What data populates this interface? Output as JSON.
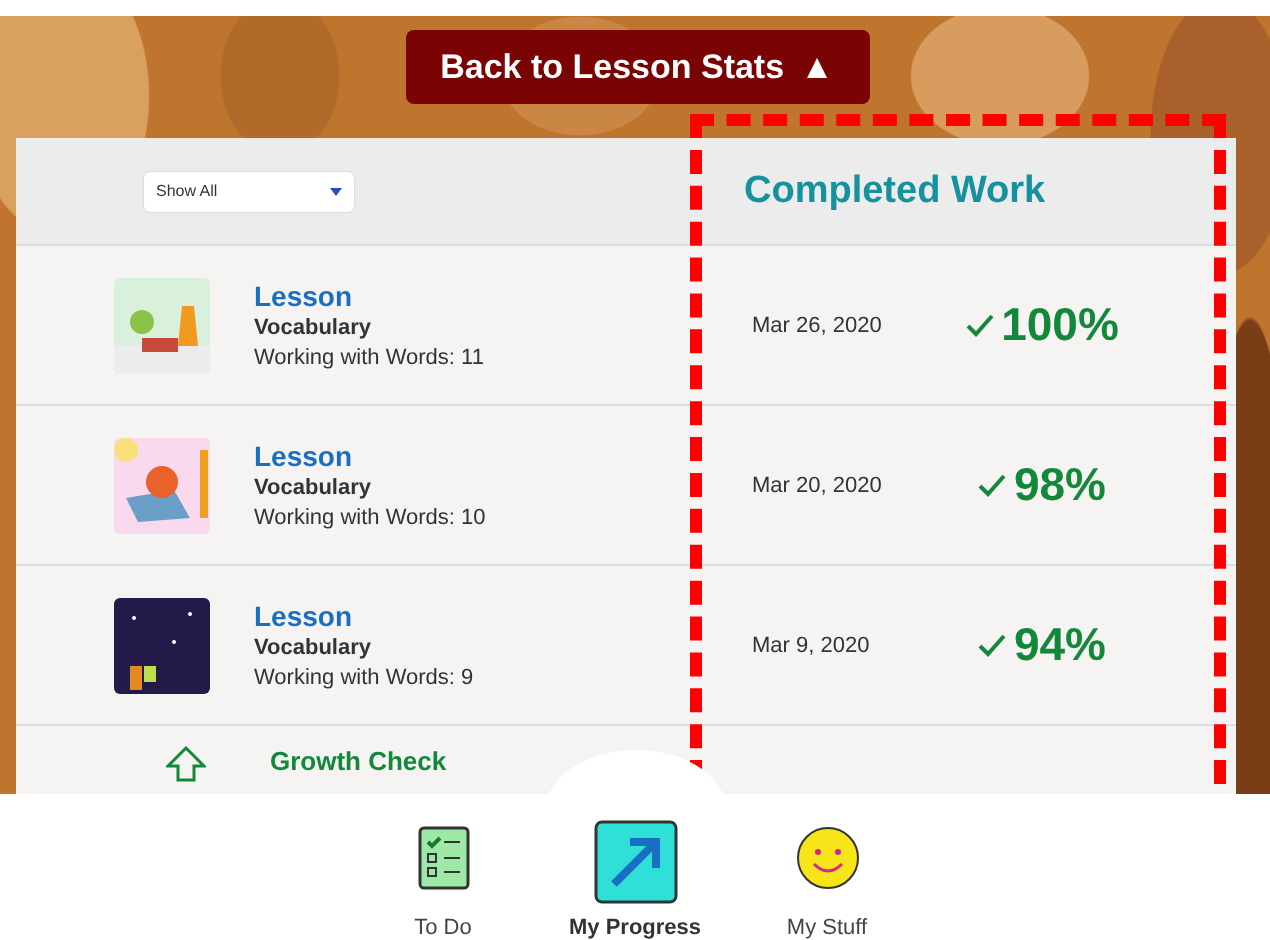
{
  "back_button": {
    "label": "Back to Lesson Stats",
    "icon": "▲"
  },
  "filter": {
    "value": "Show All"
  },
  "column_heading": "Completed Work",
  "rows": [
    {
      "kind": "meadow",
      "title": "Lesson",
      "subject": "Vocabulary",
      "detail": "Working with Words: 11",
      "date": "Mar 26, 2020",
      "score": "100%"
    },
    {
      "kind": "sunny",
      "title": "Lesson",
      "subject": "Vocabulary",
      "detail": "Working with Words: 10",
      "date": "Mar 20, 2020",
      "score": "98%"
    },
    {
      "kind": "night",
      "title": "Lesson",
      "subject": "Vocabulary",
      "detail": "Working with Words: 9",
      "date": "Mar 9, 2020",
      "score": "94%"
    }
  ],
  "partial_row": {
    "title": "Growth Check"
  },
  "nav": [
    {
      "kind": "todo",
      "label": "To Do",
      "selected": false
    },
    {
      "kind": "progress",
      "label": "My Progress",
      "selected": true
    },
    {
      "kind": "stuff",
      "label": "My Stuff",
      "selected": false
    }
  ]
}
